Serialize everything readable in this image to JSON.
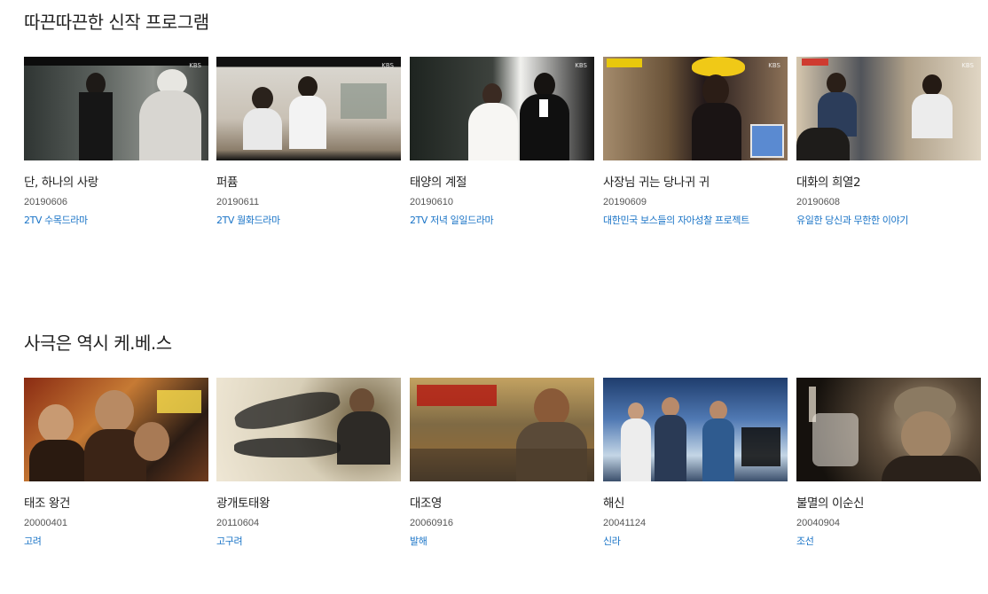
{
  "sections": [
    {
      "title": "따끈따끈한 신작 프로그램",
      "items": [
        {
          "title": "단, 하나의 사랑",
          "date": "20190606",
          "category": "2TV 수목드라마"
        },
        {
          "title": "퍼퓸",
          "date": "20190611",
          "category": "2TV 월화드라마"
        },
        {
          "title": "태양의 계절",
          "date": "20190610",
          "category": "2TV 저녁 일일드라마"
        },
        {
          "title": "사장님 귀는 당나귀 귀",
          "date": "20190609",
          "category": "대한민국 보스들의 자아성찰 프로젝트"
        },
        {
          "title": "대화의 희열2",
          "date": "20190608",
          "category": "유일한 당신과 무한한 이야기"
        }
      ]
    },
    {
      "title": "사극은 역시 케.베.스",
      "items": [
        {
          "title": "태조 왕건",
          "date": "20000401",
          "category": "고려"
        },
        {
          "title": "광개토태왕",
          "date": "20110604",
          "category": "고구려"
        },
        {
          "title": "대조영",
          "date": "20060916",
          "category": "발해"
        },
        {
          "title": "해신",
          "date": "20041124",
          "category": "신라"
        },
        {
          "title": "불멸의 이순신",
          "date": "20040904",
          "category": "조선"
        }
      ]
    }
  ],
  "thumbnail_logo": "KBS",
  "colors": {
    "category_link": "#1a74c7",
    "title_text": "#222222",
    "date_text": "#555555"
  }
}
